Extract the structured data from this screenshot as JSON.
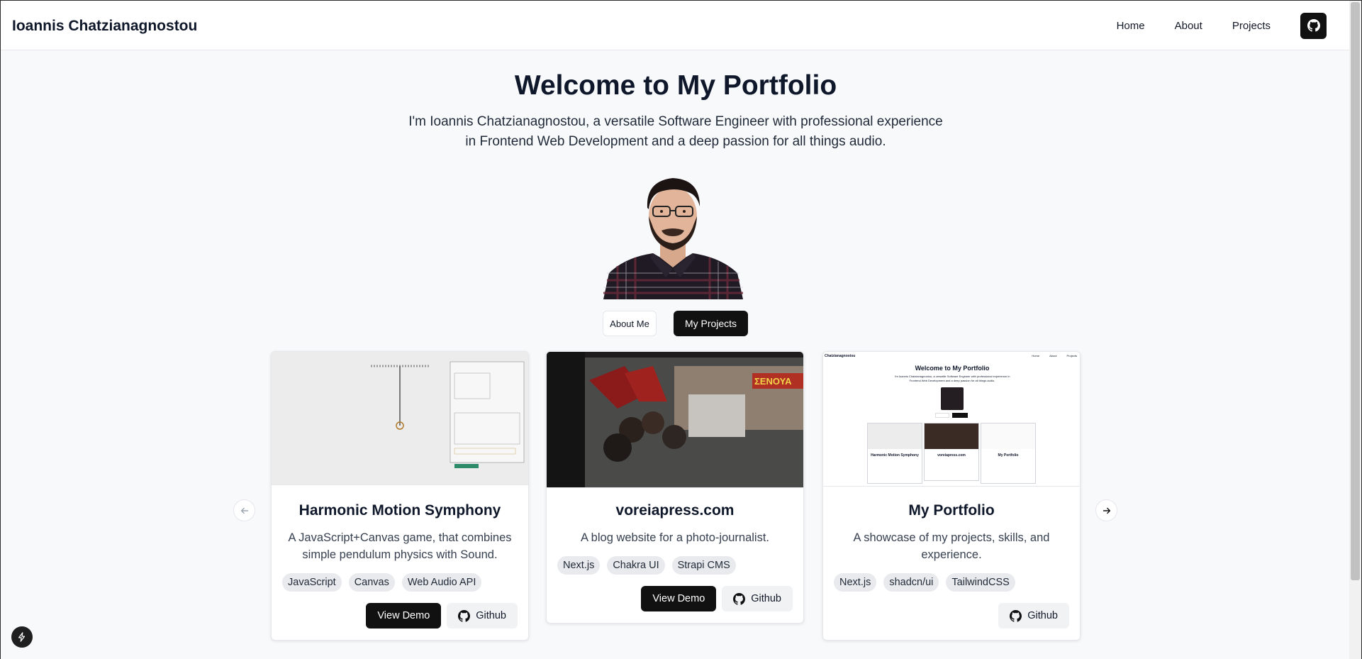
{
  "header": {
    "brand": "Ioannis Chatzianagnostou",
    "nav": [
      "Home",
      "About",
      "Projects"
    ],
    "github_icon": "github-icon"
  },
  "hero": {
    "title": "Welcome to My Portfolio",
    "subtitle": "I'm Ioannis Chatzianagnostou, a versatile Software Engineer with professional experience in Frontend Web Development and a deep passion for all things audio.",
    "about_button": "About Me",
    "projects_button": "My Projects"
  },
  "projects": [
    {
      "title": "Harmonic Motion Symphony",
      "description": "A JavaScript+Canvas game, that combines simple pendulum physics with Sound.",
      "tags": [
        "JavaScript",
        "Canvas",
        "Web Audio API"
      ],
      "demo_label": "View Demo",
      "github_label": "Github"
    },
    {
      "title": "voreiapress.com",
      "description": "A blog website for a photo-journalist.",
      "tags": [
        "Next.js",
        "Chakra UI",
        "Strapi CMS"
      ],
      "demo_label": "View Demo",
      "github_label": "Github",
      "image_text": "ΣΕΝΟΥΑ"
    },
    {
      "title": "My Portfolio",
      "description": "A showcase of my projects, skills, and experience.",
      "tags": [
        "Next.js",
        "shadcn/ui",
        "TailwindCSS"
      ],
      "github_label": "Github"
    }
  ],
  "thumb_portfolio": {
    "brand": "Chatzianagnostou",
    "nav": [
      "Home",
      "About",
      "Projects"
    ],
    "title": "Welcome to My Portfolio",
    "subtitle": "I'm Ioannis Chatzianagnostou, a versatile Software Engineer with professional experience in Frontend Web Development and a deep passion for all things audio.",
    "card_titles": [
      "Harmonic Motion Symphony",
      "voreiapress.com",
      "My Portfolio"
    ]
  },
  "colors": {
    "accent": "#111111",
    "background": "#f8f9fb",
    "tag_bg": "#e9eaed"
  }
}
